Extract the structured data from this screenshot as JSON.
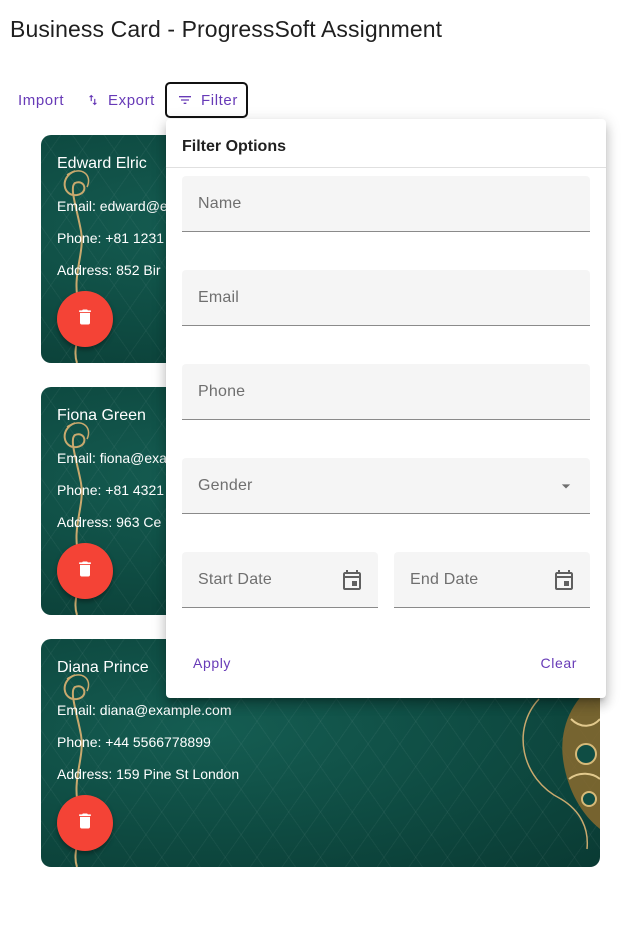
{
  "app": {
    "title": "Business Card - ProgressSoft Assignment"
  },
  "toolbar": {
    "import_label": "Import",
    "export_label": "Export",
    "filter_label": "Filter",
    "accent_color": "#673ab7"
  },
  "cards": [
    {
      "name": "Edward Elric",
      "email": "Email: edward@e",
      "phone": "Phone: +81 1231",
      "address": "Address: 852 Bir"
    },
    {
      "name": "Fiona Green",
      "email": "Email: fiona@exa",
      "phone": "Phone: +81 4321",
      "address": "Address: 963 Ce"
    },
    {
      "name": "Diana Prince",
      "email": "Email: diana@example.com",
      "phone": "Phone: +44 5566778899",
      "address": "Address: 159 Pine St London"
    }
  ],
  "card_style": {
    "background": "#0f4d44",
    "delete_button_color": "#f44336",
    "ornament_color": "#c9a96e"
  },
  "filter_panel": {
    "title": "Filter Options",
    "name_placeholder": "Name",
    "email_placeholder": "Email",
    "phone_placeholder": "Phone",
    "gender_placeholder": "Gender",
    "start_date_placeholder": "Start Date",
    "end_date_placeholder": "End Date",
    "apply_label": "Apply",
    "clear_label": "Clear"
  },
  "icons": {
    "export": "swap-vert-icon",
    "filter": "filter-list-icon",
    "delete": "trash-icon",
    "dropdown": "chevron-down-icon",
    "calendar": "calendar-icon"
  }
}
